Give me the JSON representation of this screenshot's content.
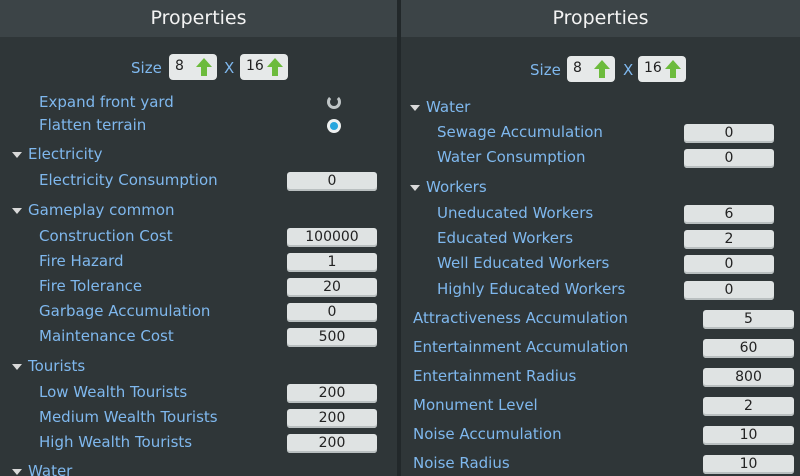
{
  "left": {
    "title": "Properties",
    "size": {
      "label": "Size",
      "x": "X",
      "width": "8",
      "length": "16"
    },
    "rows": [
      {
        "kind": "item",
        "label": "Expand front yard",
        "control": "radio-partial"
      },
      {
        "kind": "item",
        "label": "Flatten terrain",
        "control": "radio",
        "checked": true
      },
      {
        "kind": "cat",
        "label": "Electricity"
      },
      {
        "kind": "item",
        "label": "Electricity Consumption",
        "value": "0"
      },
      {
        "kind": "cat",
        "label": "Gameplay common"
      },
      {
        "kind": "item",
        "label": "Construction Cost",
        "value": "100000"
      },
      {
        "kind": "item",
        "label": "Fire Hazard",
        "value": "1"
      },
      {
        "kind": "item",
        "label": "Fire Tolerance",
        "value": "20"
      },
      {
        "kind": "item",
        "label": "Garbage Accumulation",
        "value": "0"
      },
      {
        "kind": "item",
        "label": "Maintenance Cost",
        "value": "500"
      },
      {
        "kind": "cat",
        "label": "Tourists"
      },
      {
        "kind": "item",
        "label": "Low Wealth Tourists",
        "value": "200"
      },
      {
        "kind": "item",
        "label": "Medium Wealth Tourists",
        "value": "200"
      },
      {
        "kind": "item",
        "label": "High Wealth Tourists",
        "value": "200"
      },
      {
        "kind": "cat",
        "label": "Water"
      }
    ]
  },
  "right": {
    "title": "Properties",
    "size": {
      "label": "Size",
      "x": "X",
      "width": "8",
      "length": "16"
    },
    "rows": [
      {
        "kind": "cat",
        "label": "Water"
      },
      {
        "kind": "item",
        "label": "Sewage Accumulation",
        "value": "0"
      },
      {
        "kind": "item",
        "label": "Water Consumption",
        "value": "0"
      },
      {
        "kind": "cat",
        "label": "Workers"
      },
      {
        "kind": "item",
        "label": "Uneducated Workers",
        "value": "6"
      },
      {
        "kind": "item",
        "label": "Educated Workers",
        "value": "2"
      },
      {
        "kind": "item",
        "label": "Well Educated Workers",
        "value": "0"
      },
      {
        "kind": "item",
        "label": "Highly Educated Workers",
        "value": "0"
      },
      {
        "kind": "top",
        "label": "Attractiveness Accumulation",
        "value": "5"
      },
      {
        "kind": "top",
        "label": "Entertainment Accumulation",
        "value": "60"
      },
      {
        "kind": "top",
        "label": "Entertainment Radius",
        "value": "800"
      },
      {
        "kind": "top",
        "label": "Monument Level",
        "value": "2"
      },
      {
        "kind": "top",
        "label": "Noise Accumulation",
        "value": "10"
      },
      {
        "kind": "top",
        "label": "Noise Radius",
        "value": "10"
      }
    ]
  },
  "colors": {
    "accent": "#7fb8ee",
    "radio_on": "#27a6de",
    "arrow": "#6cbb3c"
  },
  "icons": {
    "size_up": "green-up-arrow-icon",
    "category": "triangle-down-icon"
  }
}
